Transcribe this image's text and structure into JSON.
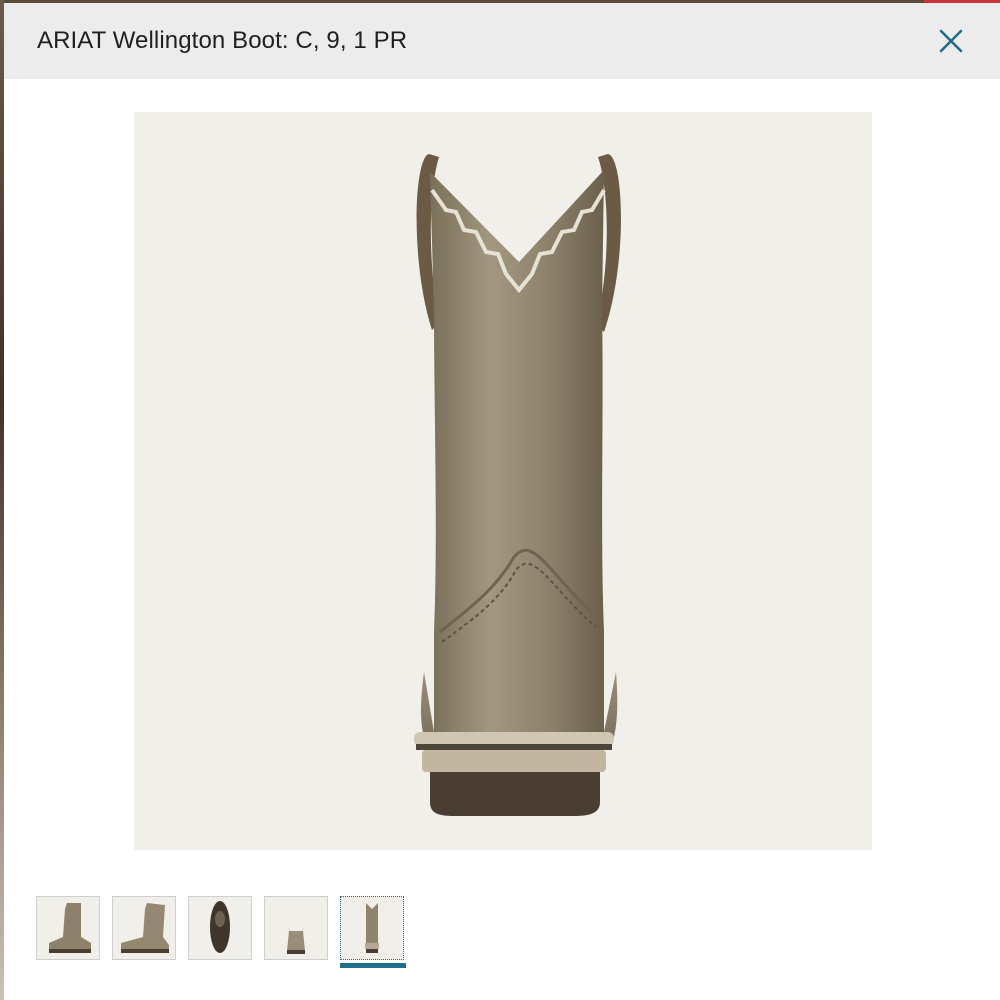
{
  "modal": {
    "title": "ARIAT Wellington Boot: C, 9, 1 PR",
    "close_icon": "close-icon"
  },
  "main_image": {
    "icon": "boot-rear-view-image"
  },
  "thumbnails": [
    {
      "icon": "boot-side-view-thumbnail",
      "selected": false
    },
    {
      "icon": "boot-angle-view-thumbnail",
      "selected": false
    },
    {
      "icon": "boot-sole-view-thumbnail",
      "selected": false
    },
    {
      "icon": "boot-front-view-thumbnail",
      "selected": false
    },
    {
      "icon": "boot-rear-view-thumbnail",
      "selected": true
    }
  ],
  "colors": {
    "accent": "#1f6f8b",
    "header_bg": "#ececec",
    "image_bg": "#f1efea"
  }
}
